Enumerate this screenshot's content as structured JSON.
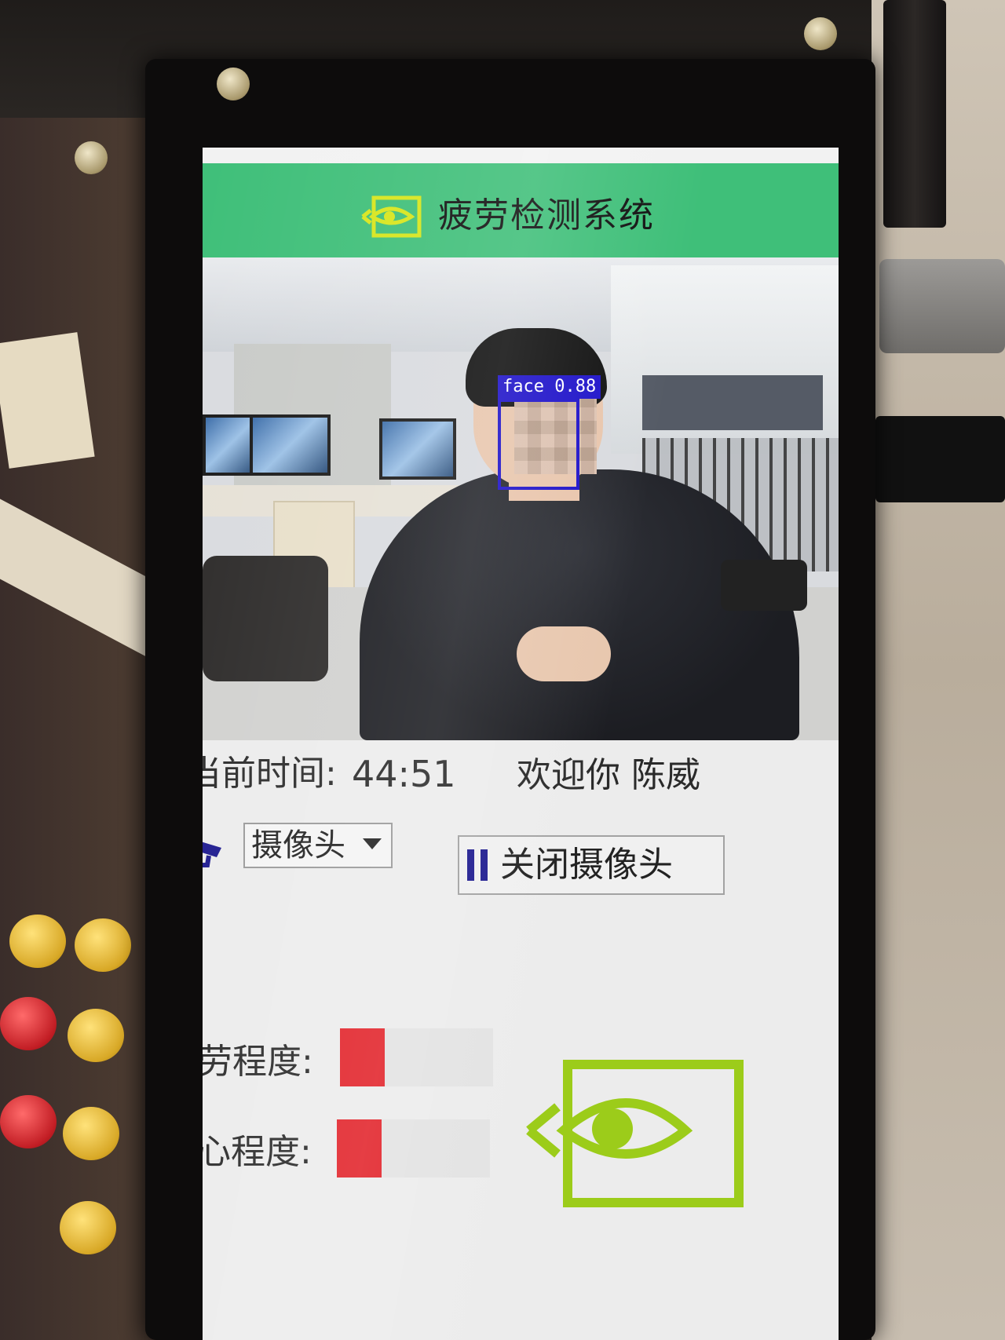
{
  "app": {
    "title": "疲劳检测系统"
  },
  "camera_feed": {
    "detection_label": "face 0.88"
  },
  "info": {
    "time_label": "当前时间:",
    "time_value": "44:51",
    "welcome": "欢迎你 陈威"
  },
  "controls": {
    "camera_select_value": "摄像头",
    "close_camera_label": "关闭摄像头"
  },
  "meters": [
    {
      "label": "疲劳程度:",
      "level": 0.29
    },
    {
      "label": "分心程度:",
      "level": 0.29
    }
  ],
  "colors": {
    "title_bar": "#3fbf79",
    "logo_green": "#9ccc1a",
    "meter_fill": "#e2232a",
    "detection_box": "#1e12c9"
  },
  "icons": {
    "title": "eye-logo-icon",
    "camera": "security-camera-icon",
    "pause": "pause-icon",
    "select_caret": "caret-down-icon",
    "big_logo": "eye-logo-icon"
  }
}
